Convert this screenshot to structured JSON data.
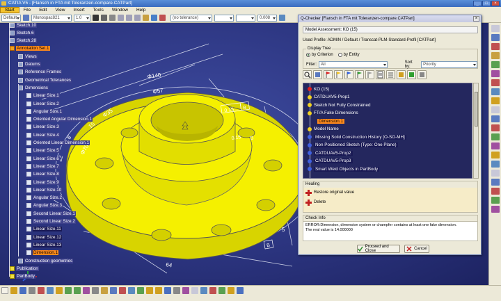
{
  "window": {
    "title": "CATIA V5 - [Flansch in FTA mit Toleranzen-compare.CATPart]",
    "controls": [
      "_",
      "□",
      "×"
    ]
  },
  "menu": [
    "Start",
    "File",
    "Edit",
    "View",
    "Insert",
    "Tools",
    "Window",
    "Help"
  ],
  "toolbar": {
    "style_combo": "Default",
    "font_combo": "Monospac821",
    "size_combo": "1.0",
    "tolerance_combo": "(no tolerance)",
    "value_combo": "0.008"
  },
  "tree": {
    "items": [
      {
        "label": "Sketch.10",
        "indent": 0,
        "icon": "sketch-icon"
      },
      {
        "label": "Sketch.6",
        "indent": 0,
        "icon": "sketch-icon"
      },
      {
        "label": "Sketch.28",
        "indent": 0,
        "icon": "sketch-icon"
      },
      {
        "label": "Annotation Set.1",
        "indent": 0,
        "icon": "annotation-set-icon",
        "selected": true
      },
      {
        "label": "Views",
        "indent": 1,
        "icon": "views-icon"
      },
      {
        "label": "Datums",
        "indent": 1,
        "icon": "datums-icon"
      },
      {
        "label": "Reference Frames",
        "indent": 1,
        "icon": "reference-frames-icon"
      },
      {
        "label": "Geometrical Tolerances",
        "indent": 1,
        "icon": "geometrical-tolerances-icon"
      },
      {
        "label": "Dimensions",
        "indent": 1,
        "icon": "dimensions-icon"
      },
      {
        "label": "Linear Size.1",
        "indent": 2,
        "icon": "dimension-icon"
      },
      {
        "label": "Linear Size.2",
        "indent": 2,
        "icon": "dimension-icon"
      },
      {
        "label": "Angular Size.1",
        "indent": 2,
        "icon": "dimension-icon"
      },
      {
        "label": "Oriented Angular Dimension.1",
        "indent": 2,
        "icon": "dimension-icon"
      },
      {
        "label": "Linear Size.3",
        "indent": 2,
        "icon": "dimension-icon"
      },
      {
        "label": "Linear Size.4",
        "indent": 2,
        "icon": "dimension-icon"
      },
      {
        "label": "Oriented Linear Dimension.1",
        "indent": 2,
        "icon": "dimension-icon"
      },
      {
        "label": "Linear Size.5",
        "indent": 2,
        "icon": "dimension-icon"
      },
      {
        "label": "Linear Size.6",
        "indent": 2,
        "icon": "dimension-icon"
      },
      {
        "label": "Linear Size.7",
        "indent": 2,
        "icon": "dimension-icon"
      },
      {
        "label": "Linear Size.8",
        "indent": 2,
        "icon": "dimension-icon"
      },
      {
        "label": "Linear Size.9",
        "indent": 2,
        "icon": "dimension-icon"
      },
      {
        "label": "Linear Size.10",
        "indent": 2,
        "icon": "dimension-icon"
      },
      {
        "label": "Angular Size.2",
        "indent": 2,
        "icon": "dimension-icon"
      },
      {
        "label": "Angular Size.3",
        "indent": 2,
        "icon": "dimension-icon"
      },
      {
        "label": "Second Linear Size.1",
        "indent": 2,
        "icon": "dimension-icon"
      },
      {
        "label": "Second Linear Size.2",
        "indent": 2,
        "icon": "dimension-icon"
      },
      {
        "label": "Linear Size.11",
        "indent": 2,
        "icon": "dimension-icon",
        "dark": true
      },
      {
        "label": "Linear Size.12",
        "indent": 2,
        "icon": "dimension-icon",
        "dark": true
      },
      {
        "label": "Linear Size.13",
        "indent": 2,
        "icon": "dimension-icon",
        "dark": true
      },
      {
        "label": "Dimension.1",
        "indent": 2,
        "icon": "dimension-icon",
        "selected": true
      },
      {
        "label": "Construction geometries",
        "indent": 1,
        "icon": "construction-geometries-icon"
      },
      {
        "label": "Publication",
        "indent": 0,
        "icon": "publication-icon"
      },
      {
        "label": "PartBody",
        "indent": 0,
        "icon": "partbody-icon"
      }
    ]
  },
  "drawing": {
    "dims": [
      "Φ140",
      "Φ57",
      "Φ35",
      "15",
      "Φ70",
      "8",
      "22",
      "B",
      "5",
      "64"
    ],
    "boxes": [
      "0.15",
      "B",
      "0.15",
      "B",
      "B"
    ]
  },
  "qchecker": {
    "title": "Q-Checker [Flansch in FTA mit Toleranzen-compare.CATPart]",
    "close": "×",
    "model_assessment": "Model Assessment: KO (15)",
    "used_profile": "Used Profile: ADMIN / Default / Transcat-PLM-Standard-Profil [CATPart]",
    "display_tree": {
      "label": "Display Tree",
      "criterion": "by Criterion",
      "entity": "by Entity",
      "filter_label": "Filter:",
      "filter_value": "All",
      "sort_label": "Sort by:",
      "sort_value": "Priority"
    },
    "tree": [
      {
        "label": "KO (15)",
        "dot": "red",
        "indent": 0
      },
      {
        "label": "CATDUAV5-Prop1",
        "dot": "yellow",
        "indent": 0
      },
      {
        "label": "Sketch Not Fully Constrained",
        "dot": "yellow",
        "indent": 0
      },
      {
        "label": "FT/A Fake Dimensions",
        "dot": "yellow",
        "indent": 0
      },
      {
        "label": "Dimension.1",
        "dot": "",
        "indent": 1,
        "selected": true
      },
      {
        "label": "Model Name",
        "dot": "yellow",
        "indent": 0
      },
      {
        "label": "Missing Solid Construction History [O-SO-MH]",
        "dot": "blue",
        "indent": 0,
        "dark": true
      },
      {
        "label": "Non Positioned Sketch (Type: One Plane)",
        "dot": "blue",
        "indent": 0,
        "dark": true
      },
      {
        "label": "CATDUAV5-Prop2",
        "dot": "blue",
        "indent": 0,
        "dark": true
      },
      {
        "label": "CATDUAV5-Prop3",
        "dot": "blue",
        "indent": 0,
        "dark": true
      },
      {
        "label": "Smart Weld Objects in PartBody",
        "dot": "blue",
        "indent": 0,
        "dark": true
      }
    ],
    "healing": {
      "label": "Healing",
      "restore": "Restore original value",
      "delete": "Delete"
    },
    "check_info": {
      "label": "Check Info",
      "line1": "ERROR:Dimension, dimension system or champfer contains at least one fake dimension.",
      "line2": "The real value is 14.000000"
    },
    "buttons": {
      "proceed": "Proceed and Close",
      "cancel": "Cancel"
    }
  },
  "colors": {
    "viewport": "#2c3580",
    "part": "#f5f000",
    "selection": "#ff8a1c",
    "panel": "#ece9d8"
  }
}
